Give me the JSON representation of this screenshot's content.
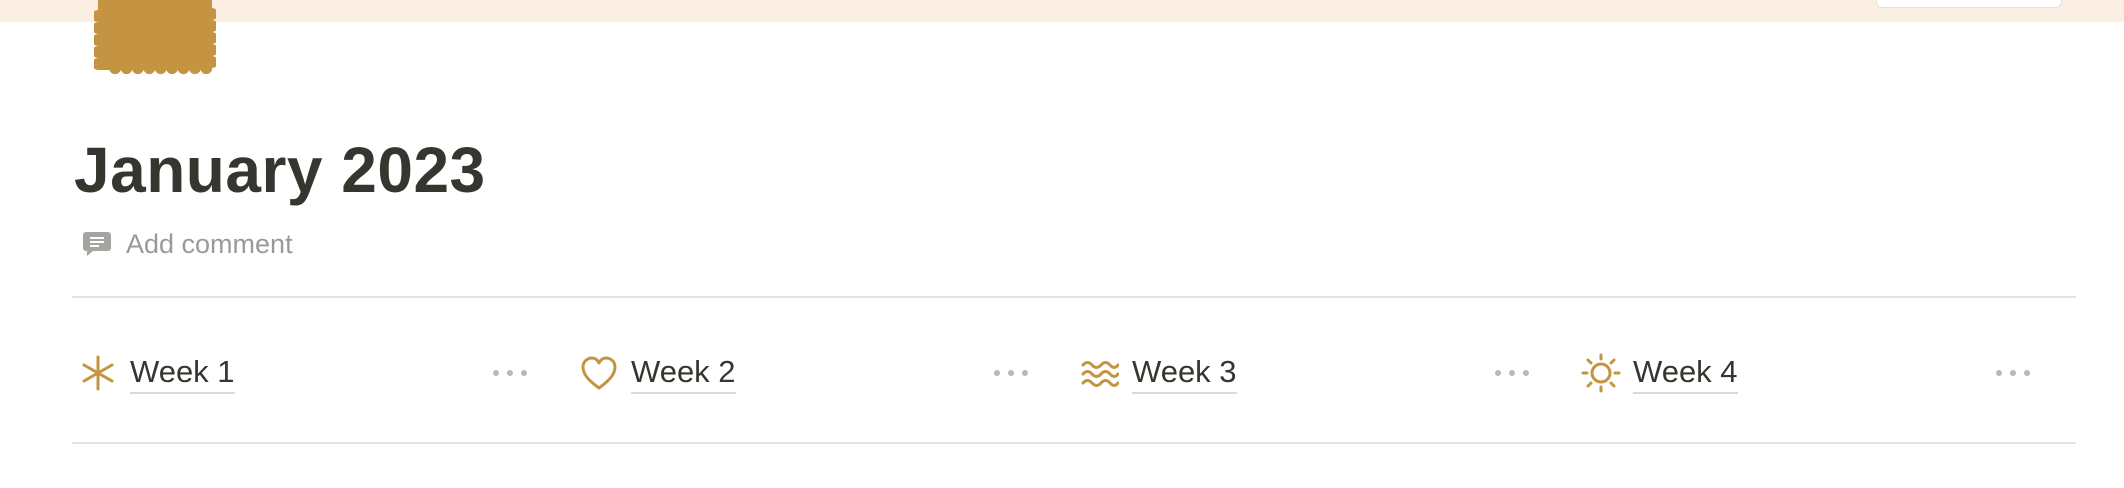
{
  "page": {
    "title": "January 2023",
    "add_comment_label": "Add comment"
  },
  "colors": {
    "cover": "#fbeee2",
    "icon_gold": "#c49443",
    "text": "#37352f",
    "muted": "#9b9a97"
  },
  "weeks": [
    {
      "label": "Week 1",
      "icon": "asterisk-icon"
    },
    {
      "label": "Week 2",
      "icon": "heart-icon"
    },
    {
      "label": "Week 3",
      "icon": "waves-icon"
    },
    {
      "label": "Week 4",
      "icon": "sun-icon"
    }
  ]
}
